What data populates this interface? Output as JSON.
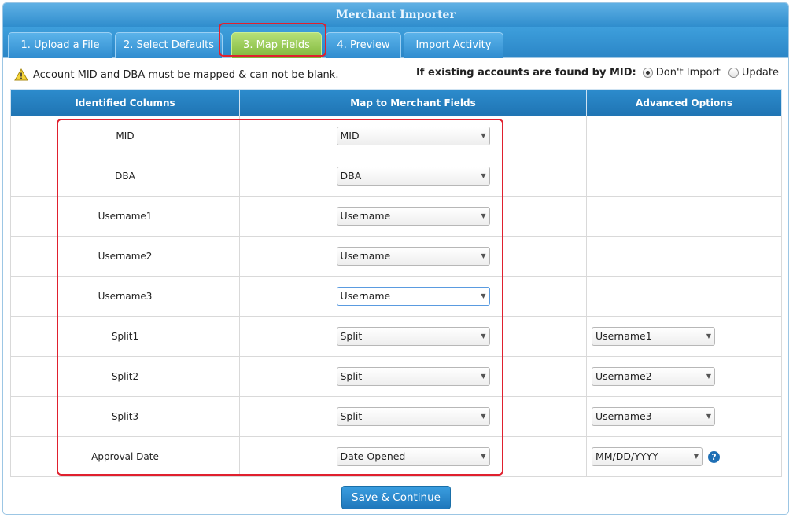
{
  "window": {
    "title": "Merchant Importer"
  },
  "tabs": [
    {
      "label": "1. Upload a File"
    },
    {
      "label": "2. Select Defaults"
    },
    {
      "label": "3. Map Fields"
    },
    {
      "label": "4. Preview"
    },
    {
      "label": "Import Activity"
    }
  ],
  "notice": {
    "text": "Account MID and DBA must be mapped & can not be blank."
  },
  "existing": {
    "label": "If existing accounts are found by MID:",
    "options": [
      "Don't Import",
      "Update"
    ],
    "selected": "Don't Import"
  },
  "table": {
    "headers": [
      "Identified Columns",
      "Map to Merchant Fields",
      "Advanced Options"
    ],
    "rows": [
      {
        "column": "MID",
        "map": "MID",
        "advanced": ""
      },
      {
        "column": "DBA",
        "map": "DBA",
        "advanced": ""
      },
      {
        "column": "Username1",
        "map": "Username",
        "advanced": ""
      },
      {
        "column": "Username2",
        "map": "Username",
        "advanced": ""
      },
      {
        "column": "Username3",
        "map": "Username",
        "advanced": ""
      },
      {
        "column": "Split1",
        "map": "Split",
        "advanced": "Username1"
      },
      {
        "column": "Split2",
        "map": "Split",
        "advanced": "Username2"
      },
      {
        "column": "Split3",
        "map": "Split",
        "advanced": "Username3"
      },
      {
        "column": "Approval Date",
        "map": "Date Opened",
        "advanced": "MM/DD/YYYY"
      }
    ]
  },
  "actions": {
    "save_label": "Save & Continue"
  },
  "colors": {
    "accent": "#2f8dcd",
    "active_tab": "#8cc34a",
    "highlight": "#e0202e",
    "help": "#1e6fb5"
  },
  "icons": {
    "warning": "warning-icon",
    "help": "help-icon",
    "dropdown": "chevron-down-icon"
  }
}
